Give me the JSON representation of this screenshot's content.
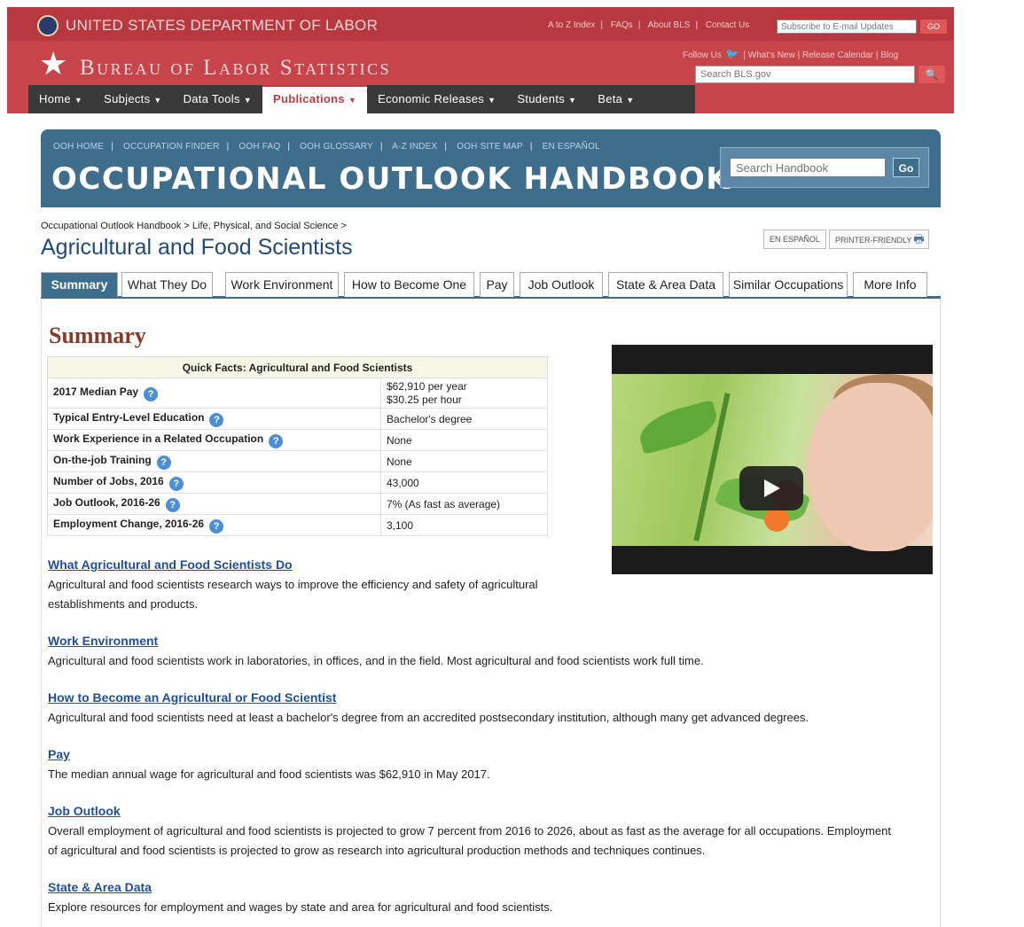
{
  "dol": {
    "title": "UNITED STATES DEPARTMENT OF LABOR",
    "util_links": [
      "A to Z Index",
      "FAQs",
      "About BLS",
      "Contact Us"
    ],
    "email_placeholder": "Subscribe to E-mail Updates",
    "email_go": "GO"
  },
  "bls": {
    "title": "Bureau of Labor Statistics",
    "follow_label": "Follow Us",
    "links": [
      "What's New",
      "Release Calendar",
      "Blog"
    ],
    "search_placeholder": "Search BLS.gov"
  },
  "nav": {
    "items": [
      "Home",
      "Subjects",
      "Data Tools",
      "Publications",
      "Economic Releases",
      "Students",
      "Beta"
    ]
  },
  "ooh": {
    "links": [
      "OOH HOME",
      "OCCUPATION FINDER",
      "OOH FAQ",
      "OOH GLOSSARY",
      "A-Z INDEX",
      "OOH SITE MAP",
      "EN ESPAÑOL"
    ],
    "title": "OCCUPATIONAL OUTLOOK HANDBOOK",
    "search_placeholder": "Search Handbook",
    "go": "Go"
  },
  "page": {
    "breadcrumb": "Occupational Outlook Handbook > Life, Physical, and Social Science >",
    "title": "Agricultural and Food Scientists",
    "espanol": "EN ESPAÑOL",
    "printer": "PRINTER-FRIENDLY"
  },
  "tabs": [
    "Summary",
    "What They Do",
    "Work Environment",
    "How to Become One",
    "Pay",
    "Job Outlook",
    "State & Area Data",
    "Similar Occupations",
    "More Info"
  ],
  "summary": {
    "heading": "Summary",
    "table_title": "Quick Facts: Agricultural and Food Scientists",
    "rows": [
      {
        "label": "2017 Median Pay",
        "value": "$62,910 per year",
        "value2": "$30.25 per hour"
      },
      {
        "label": "Typical Entry-Level Education",
        "value": "Bachelor's degree"
      },
      {
        "label": "Work Experience in a Related Occupation",
        "value": "None"
      },
      {
        "label": "On-the-job Training",
        "value": "None"
      },
      {
        "label": "Number of Jobs, 2016",
        "value": "43,000"
      },
      {
        "label": "Job Outlook, 2016-26",
        "value": "7% (As fast as average)"
      },
      {
        "label": "Employment Change, 2016-26",
        "value": "3,100"
      }
    ]
  },
  "sections": [
    {
      "link": "What Agricultural and Food Scientists Do",
      "text": "Agricultural and food scientists research ways to improve the efficiency and safety of agricultural establishments and products."
    },
    {
      "link": "Work Environment",
      "text": "Agricultural and food scientists work in laboratories, in offices, and in the field. Most agricultural and food scientists work full time."
    },
    {
      "link": "How to Become an Agricultural or Food Scientist",
      "text": "Agricultural and food scientists need at least a bachelor's degree from an accredited postsecondary institution, although many get advanced degrees."
    },
    {
      "link": "Pay",
      "text": "The median annual wage for agricultural and food scientists was $62,910 in May 2017."
    },
    {
      "link": "Job Outlook",
      "text": "Overall employment of agricultural and food scientists is projected to grow 7 percent from 2016 to 2026, about as fast as the average for all occupations. Employment of agricultural and food scientists is projected to grow as research into agricultural production methods and techniques continues."
    },
    {
      "link": "State & Area Data",
      "text": "Explore resources for employment and wages by state and area for agricultural and food scientists."
    }
  ]
}
